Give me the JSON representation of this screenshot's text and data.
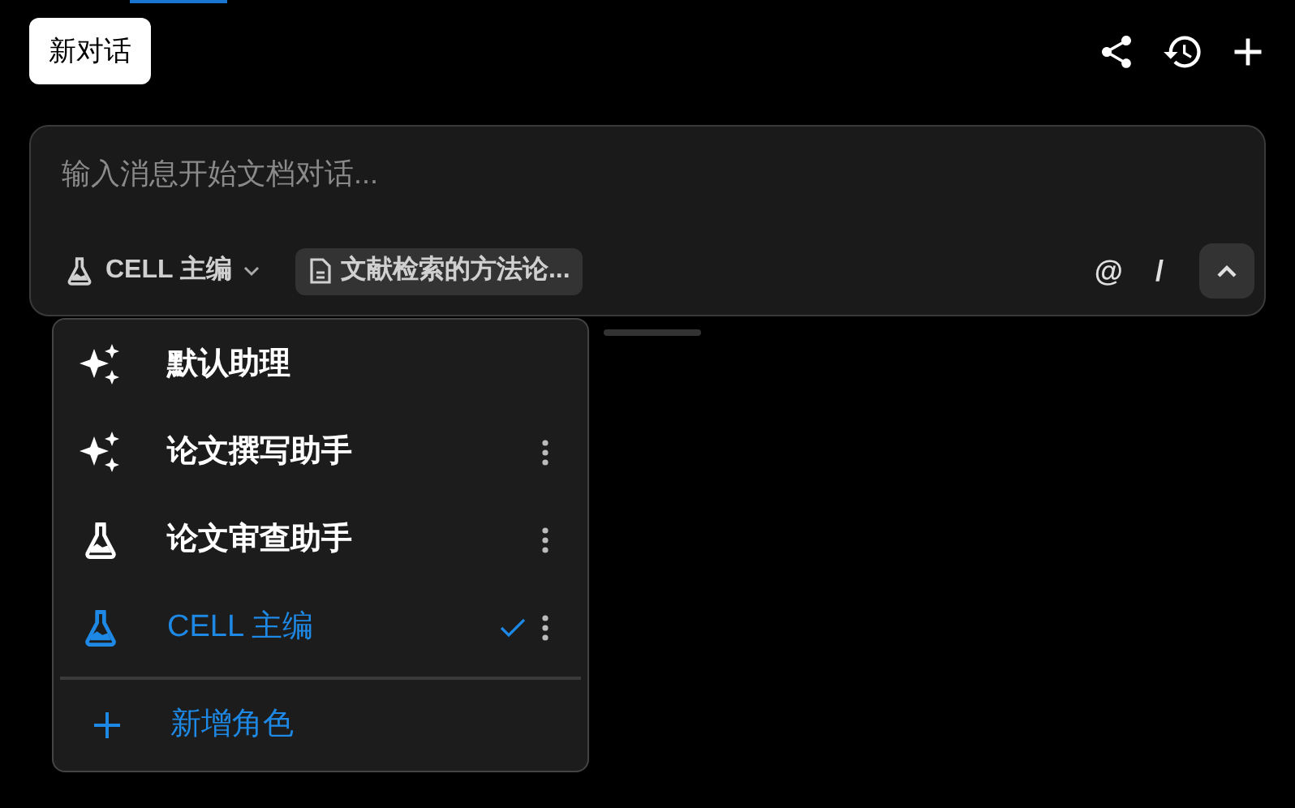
{
  "header": {
    "new_chat_button": "新对话"
  },
  "composer": {
    "placeholder": "输入消息开始文档对话...",
    "role_selector": "CELL 主编",
    "document_chip": "文献检索的方法论...",
    "mention": "@",
    "command": "/",
    "collapse_expanded": true
  },
  "role_menu": {
    "items": [
      {
        "kind": "sparkle",
        "label": "默认助理",
        "selected": false,
        "has_menu": false
      },
      {
        "kind": "sparkle",
        "label": "论文撰写助手",
        "selected": false,
        "has_menu": true
      },
      {
        "kind": "flask",
        "label": "论文审查助手",
        "selected": false,
        "has_menu": true
      },
      {
        "kind": "flask",
        "label": "CELL 主编",
        "selected": true,
        "has_menu": true
      }
    ],
    "add_label": "新增角色"
  }
}
